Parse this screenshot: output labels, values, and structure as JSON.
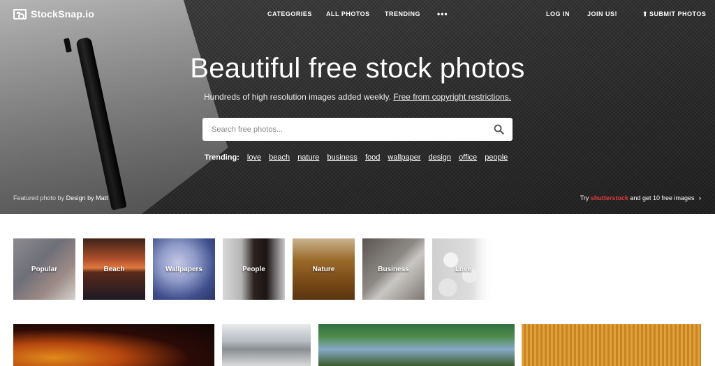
{
  "nav": {
    "logo_text": "StockSnap.io",
    "links": [
      "CATEGORIES",
      "ALL PHOTOS",
      "TRENDING"
    ],
    "more_icon": "ellipsis-icon",
    "login": "LOG IN",
    "join": "JOIN US!",
    "submit": "SUBMIT PHOTOS"
  },
  "hero": {
    "title": "Beautiful free stock photos",
    "subtitle": "Hundreds of high resolution images added weekly.",
    "subtitle_link": "Free from copyright restrictions.",
    "search_placeholder": "Search free photos...",
    "trending_label": "Trending:",
    "trending_tags": [
      "love",
      "beach",
      "nature",
      "business",
      "food",
      "wallpaper",
      "design",
      "office",
      "people"
    ],
    "featured_prefix": "Featured photo by",
    "featured_author": "Design by Matt",
    "promo_prefix": "Try",
    "promo_brand": "shutterstock",
    "promo_suffix": "and get 10 free images"
  },
  "categories": [
    "Popular",
    "Beach",
    "Wallpapers",
    "People",
    "Nature",
    "Business",
    "Love"
  ],
  "colors": {
    "accent_red": "#e23b3b",
    "text_white": "#ffffff"
  }
}
